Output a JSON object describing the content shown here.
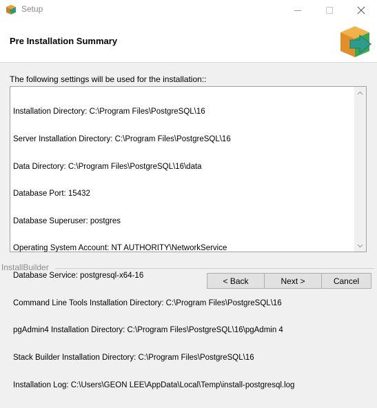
{
  "window": {
    "title": "Setup",
    "icon": "setup-box-icon",
    "controls": [
      "minimize-icon",
      "maximize-icon",
      "close-icon"
    ]
  },
  "header": {
    "title": "Pre Installation Summary",
    "logo_icon": "installer-box-arrow-icon"
  },
  "summary": {
    "label": "The following settings will be used for the installation::",
    "lines": [
      "Installation Directory: C:\\Program Files\\PostgreSQL\\16",
      "Server Installation Directory: C:\\Program Files\\PostgreSQL\\16",
      "Data Directory: C:\\Program Files\\PostgreSQL\\16\\data",
      "Database Port: 15432",
      "Database Superuser: postgres",
      "Operating System Account: NT AUTHORITY\\NetworkService",
      "Database Service: postgresql-x64-16",
      "Command Line Tools Installation Directory: C:\\Program Files\\PostgreSQL\\16",
      "pgAdmin4 Installation Directory: C:\\Program Files\\PostgreSQL\\16\\pgAdmin 4",
      "Stack Builder Installation Directory: C:\\Program Files\\PostgreSQL\\16",
      "Installation Log: C:\\Users\\GEON LEE\\AppData\\Local\\Temp\\install-postgresql.log"
    ]
  },
  "footer": {
    "brand": "InstallBuilder",
    "back_label": "< Back",
    "next_label": "Next >",
    "cancel_label": "Cancel"
  },
  "colors": {
    "title_gray": "#8a8a8a",
    "logo_green": "#3aa655",
    "logo_teal": "#2e9b8c",
    "logo_orange": "#e0902a"
  }
}
